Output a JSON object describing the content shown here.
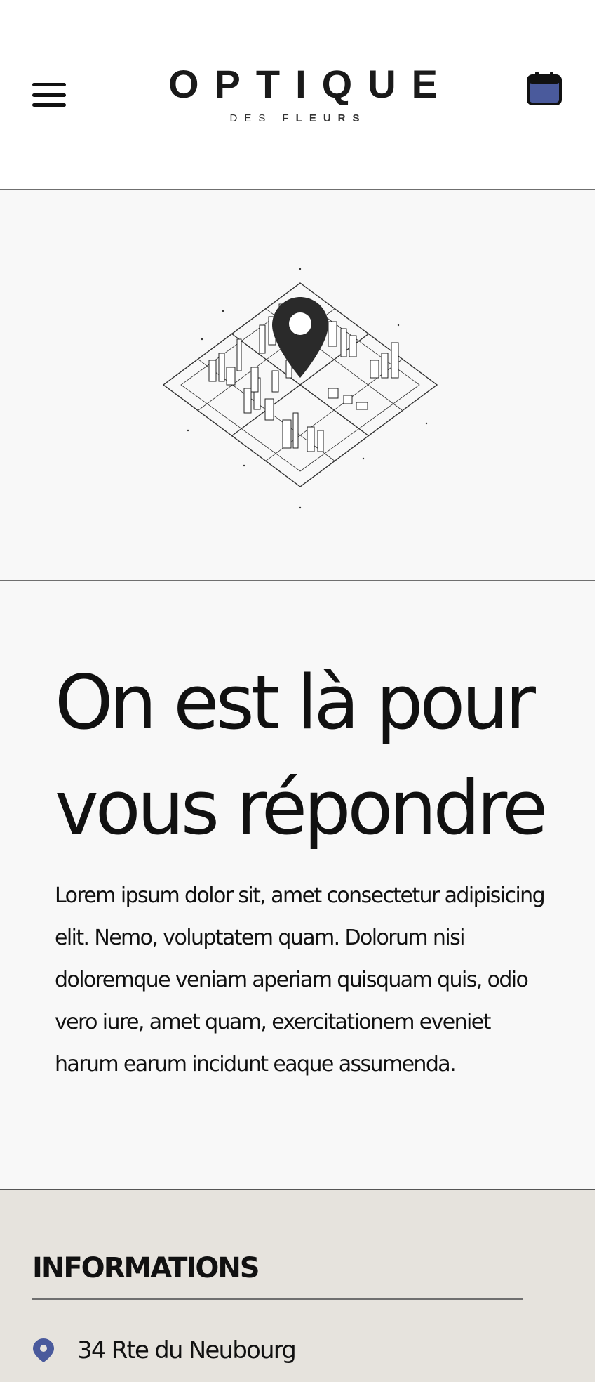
{
  "header": {
    "logo_main": "OPTIQUE",
    "logo_sub_light": "DES F",
    "logo_sub_bold": "LEURS",
    "menu_icon": "hamburger-menu-icon",
    "calendar_icon": "calendar-icon"
  },
  "map": {
    "illustration": "isometric-city-map-with-location-pin"
  },
  "contact": {
    "headline_line1": "On est là pour",
    "headline_line2": "vous répondre",
    "body": "Lorem ipsum dolor sit, amet consectetur adipisicing elit. Nemo, voluptatem quam. Dolorum nisi doloremque veniam aperiam quisquam quis, odio vero iure, amet quam, exercitationem eveniet harum earum incidunt eaque assumenda."
  },
  "info": {
    "title": "INFORMATIONS",
    "address": "34 Rte du Neubourg",
    "address_icon": "location-pin-icon"
  },
  "colors": {
    "accent": "#4a5a9c",
    "section_bg": "#f8f8f8",
    "info_bg": "#e6e3dd",
    "text": "#111111"
  }
}
